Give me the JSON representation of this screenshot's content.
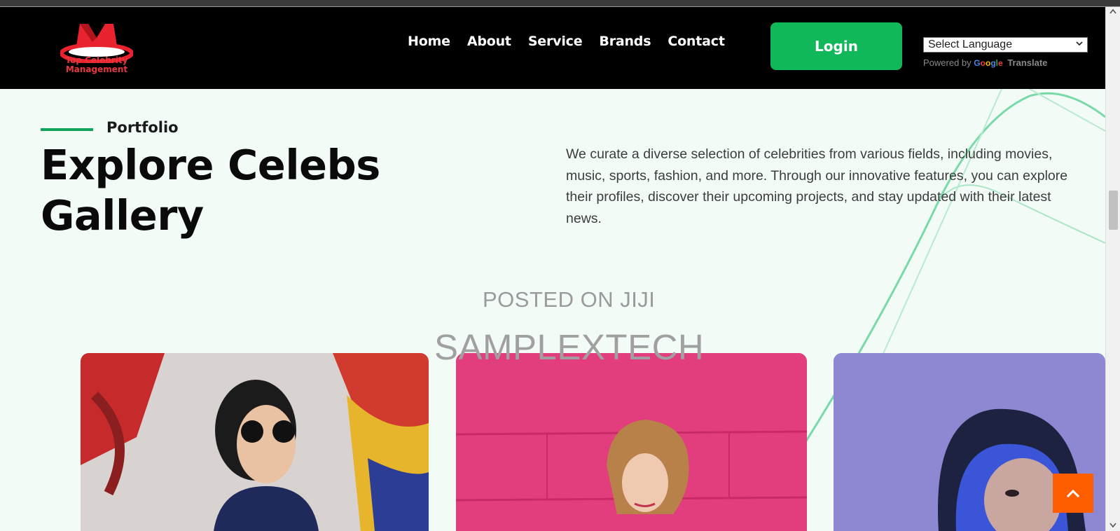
{
  "logo": {
    "line1": "Top Celebrity",
    "line2": "Management",
    "icon": "crown-m-logo"
  },
  "nav": {
    "items": [
      "Home",
      "About",
      "Service",
      "Brands",
      "Contact"
    ],
    "login_label": "Login"
  },
  "language": {
    "selected": "Select Language",
    "powered_by": "Powered by",
    "google": "Google",
    "translate": "Translate"
  },
  "section": {
    "eyebrow": "Portfolio",
    "title_line1": "Explore Celebs",
    "title_line2": "Gallery",
    "description": "We curate a diverse selection of celebrities from various fields, including movies, music, sports, fashion, and more. Through our innovative features, you can explore their profiles, discover their upcoming projects, and stay updated with their latest news."
  },
  "watermark": {
    "line1": "POSTED ON JIJI",
    "line2": "SAMPLEXTECH"
  },
  "gallery": {
    "cards": [
      {
        "name": "celeb-photo-graffiti-sunglasses"
      },
      {
        "name": "celeb-photo-pink-wall"
      },
      {
        "name": "celeb-photo-blue-portrait"
      }
    ]
  },
  "colors": {
    "accent": "#10b859",
    "scroll_top": "#ff5e00",
    "nav_bg": "#000000",
    "page_bg": "#f3fbf7"
  },
  "icons": {
    "scroll_top": "chevron-up-icon",
    "select": "chevron-down-icon"
  }
}
